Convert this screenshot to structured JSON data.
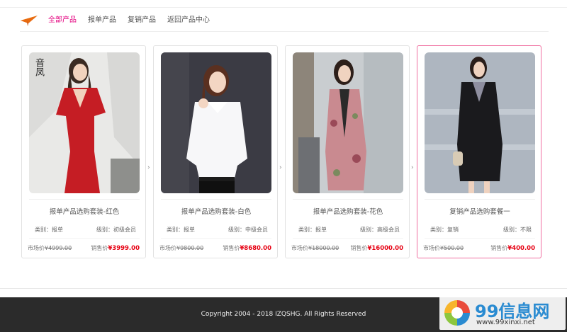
{
  "nav": {
    "tabs": [
      {
        "label": "全部产品",
        "active": true
      },
      {
        "label": "报单产品",
        "active": false
      },
      {
        "label": "复销产品",
        "active": false
      },
      {
        "label": "返回产品中心",
        "active": false
      }
    ],
    "accent_color": "#e4007f"
  },
  "products": [
    {
      "title": "报单产品选购套装-红色",
      "category_label": "类别：",
      "category": "报单",
      "level_label": "级别：",
      "level": "初级会员",
      "market_label": "市场价",
      "market_price": "¥4999.00",
      "sale_label": "销售价",
      "sale_price": "¥3999.00",
      "photo_caption": "音凤"
    },
    {
      "title": "报单产品选购套装-白色",
      "category_label": "类别：",
      "category": "报单",
      "level_label": "级别：",
      "level": "中级会员",
      "market_label": "市场价",
      "market_price": "¥9800.00",
      "sale_label": "销售价",
      "sale_price": "¥8680.00"
    },
    {
      "title": "报单产品选购套装-花色",
      "category_label": "类别：",
      "category": "报单",
      "level_label": "级别：",
      "level": "高级会员",
      "market_label": "市场价",
      "market_price": "¥18000.00",
      "sale_label": "销售价",
      "sale_price": "¥16000.00"
    },
    {
      "title": "复销产品选购套餐一",
      "category_label": "类别：",
      "category": "复销",
      "level_label": "级别：",
      "level": "不限",
      "market_label": "市场价",
      "market_price": "¥500.00",
      "sale_label": "销售价",
      "sale_price": "¥400.00"
    }
  ],
  "footer": {
    "copyright": "Copyright 2004 - 2018 IZQSHG. All Rights Reserved"
  },
  "watermark": {
    "brand_num": "99",
    "brand_text": "信息网",
    "url": "www.99xinxi.net"
  },
  "colors": {
    "sale_price": "#e60012",
    "highlight_border": "#f06fa0",
    "footer_bg": "#2b2b2b"
  }
}
